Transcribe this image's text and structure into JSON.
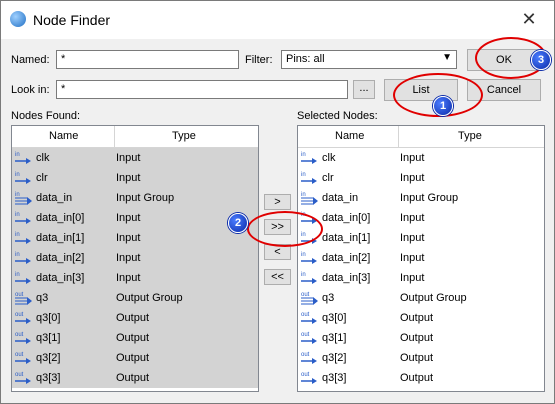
{
  "window": {
    "title": "Node Finder",
    "close_glyph": "✕"
  },
  "named": {
    "label": "Named:",
    "value": "*"
  },
  "filter": {
    "label": "Filter:",
    "value": "Pins: all"
  },
  "look_in": {
    "label": "Look in:",
    "value": "*",
    "browse_label": "..."
  },
  "buttons": {
    "ok": "OK",
    "list": "List",
    "cancel": "Cancel",
    "move_right": ">",
    "move_all_right": ">>",
    "move_left": "<",
    "move_all_left": "<<"
  },
  "nodes_found": {
    "label": "Nodes Found:",
    "columns": [
      "Name",
      "Type"
    ],
    "rows": [
      {
        "name": "clk",
        "type": "Input",
        "icon": "input-pin-icon"
      },
      {
        "name": "clr",
        "type": "Input",
        "icon": "input-pin-icon"
      },
      {
        "name": "data_in",
        "type": "Input Group",
        "icon": "input-group-icon"
      },
      {
        "name": "data_in[0]",
        "type": "Input",
        "icon": "input-pin-icon"
      },
      {
        "name": "data_in[1]",
        "type": "Input",
        "icon": "input-pin-icon"
      },
      {
        "name": "data_in[2]",
        "type": "Input",
        "icon": "input-pin-icon"
      },
      {
        "name": "data_in[3]",
        "type": "Input",
        "icon": "input-pin-icon"
      },
      {
        "name": "q3",
        "type": "Output Group",
        "icon": "output-group-icon"
      },
      {
        "name": "q3[0]",
        "type": "Output",
        "icon": "output-pin-icon"
      },
      {
        "name": "q3[1]",
        "type": "Output",
        "icon": "output-pin-icon"
      },
      {
        "name": "q3[2]",
        "type": "Output",
        "icon": "output-pin-icon"
      },
      {
        "name": "q3[3]",
        "type": "Output",
        "icon": "output-pin-icon"
      }
    ]
  },
  "selected_nodes": {
    "label": "Selected Nodes:",
    "columns": [
      "Name",
      "Type"
    ],
    "rows": [
      {
        "name": "clk",
        "type": "Input",
        "icon": "input-pin-icon"
      },
      {
        "name": "clr",
        "type": "Input",
        "icon": "input-pin-icon"
      },
      {
        "name": "data_in",
        "type": "Input Group",
        "icon": "input-group-icon"
      },
      {
        "name": "data_in[0]",
        "type": "Input",
        "icon": "input-pin-icon"
      },
      {
        "name": "data_in[1]",
        "type": "Input",
        "icon": "input-pin-icon"
      },
      {
        "name": "data_in[2]",
        "type": "Input",
        "icon": "input-pin-icon"
      },
      {
        "name": "data_in[3]",
        "type": "Input",
        "icon": "input-pin-icon"
      },
      {
        "name": "q3",
        "type": "Output Group",
        "icon": "output-group-icon"
      },
      {
        "name": "q3[0]",
        "type": "Output",
        "icon": "output-pin-icon"
      },
      {
        "name": "q3[1]",
        "type": "Output",
        "icon": "output-pin-icon"
      },
      {
        "name": "q3[2]",
        "type": "Output",
        "icon": "output-pin-icon"
      },
      {
        "name": "q3[3]",
        "type": "Output",
        "icon": "output-pin-icon"
      }
    ]
  },
  "annotations": {
    "step1": "1",
    "step2": "2",
    "step3": "3",
    "color": "#e00000",
    "badge_color": "#0a2aa8"
  }
}
